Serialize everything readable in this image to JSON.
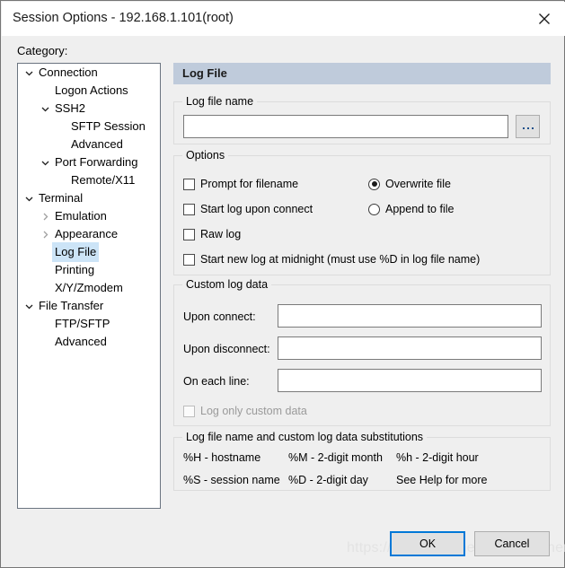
{
  "window": {
    "title": "Session Options - 192.168.1.101(root)",
    "close_icon": "close-icon"
  },
  "category": {
    "label": "Category:",
    "items": [
      {
        "label": "Connection",
        "indent": 0,
        "state": "expanded",
        "selected": false
      },
      {
        "label": "Logon Actions",
        "indent": 1,
        "state": "leaf",
        "selected": false
      },
      {
        "label": "SSH2",
        "indent": 1,
        "state": "expanded",
        "selected": false
      },
      {
        "label": "SFTP Session",
        "indent": 2,
        "state": "leaf",
        "selected": false
      },
      {
        "label": "Advanced",
        "indent": 2,
        "state": "leaf",
        "selected": false
      },
      {
        "label": "Port Forwarding",
        "indent": 1,
        "state": "expanded",
        "selected": false
      },
      {
        "label": "Remote/X11",
        "indent": 2,
        "state": "leaf",
        "selected": false
      },
      {
        "label": "Terminal",
        "indent": 0,
        "state": "expanded",
        "selected": false
      },
      {
        "label": "Emulation",
        "indent": 1,
        "state": "collapsed",
        "selected": false
      },
      {
        "label": "Appearance",
        "indent": 1,
        "state": "collapsed",
        "selected": false
      },
      {
        "label": "Log File",
        "indent": 1,
        "state": "leaf",
        "selected": true
      },
      {
        "label": "Printing",
        "indent": 1,
        "state": "leaf",
        "selected": false
      },
      {
        "label": "X/Y/Zmodem",
        "indent": 1,
        "state": "leaf",
        "selected": false
      },
      {
        "label": "File Transfer",
        "indent": 0,
        "state": "expanded",
        "selected": false
      },
      {
        "label": "FTP/SFTP",
        "indent": 1,
        "state": "leaf",
        "selected": false
      },
      {
        "label": "Advanced",
        "indent": 1,
        "state": "leaf",
        "selected": false
      }
    ]
  },
  "pane": {
    "header": "Log File",
    "logfile_group": {
      "title": "Log file name",
      "input_value": "",
      "input_placeholder": "",
      "browse_label": "..."
    },
    "options_group": {
      "title": "Options",
      "checkboxes": [
        {
          "label": "Prompt for filename",
          "checked": false,
          "disabled": false
        },
        {
          "label": "Start log upon connect",
          "checked": false,
          "disabled": false
        },
        {
          "label": "Raw log",
          "checked": false,
          "disabled": false
        },
        {
          "label": "Start new log at midnight (must use %D in log file name)",
          "checked": false,
          "disabled": false
        }
      ],
      "radios": [
        {
          "label": "Overwrite file",
          "checked": true
        },
        {
          "label": "Append to file",
          "checked": false
        }
      ]
    },
    "custom_group": {
      "title": "Custom log data",
      "fields": [
        {
          "label": "Upon connect:",
          "value": ""
        },
        {
          "label": "Upon disconnect:",
          "value": ""
        },
        {
          "label": "On each line:",
          "value": ""
        }
      ],
      "checkbox": {
        "label": "Log only custom data",
        "checked": false,
        "disabled": true
      }
    },
    "subs_group": {
      "title": "Log file name and custom log data substitutions",
      "entries": [
        "%H - hostname",
        "%M - 2-digit month",
        "%h - 2-digit hour",
        "%S - session name",
        "%D - 2-digit day",
        "See Help for more"
      ]
    }
  },
  "footer": {
    "ok_label": "OK",
    "cancel_label": "Cancel"
  },
  "watermark": {
    "text": "https://blog.csdn.net/combeginner"
  },
  "colors": {
    "dialog_bg": "#efefef",
    "pane_header_bg": "#bfcbdb",
    "tree_selection": "#cce4f7",
    "focus_border": "#0078d7",
    "field_border": "#7a7a7a"
  }
}
